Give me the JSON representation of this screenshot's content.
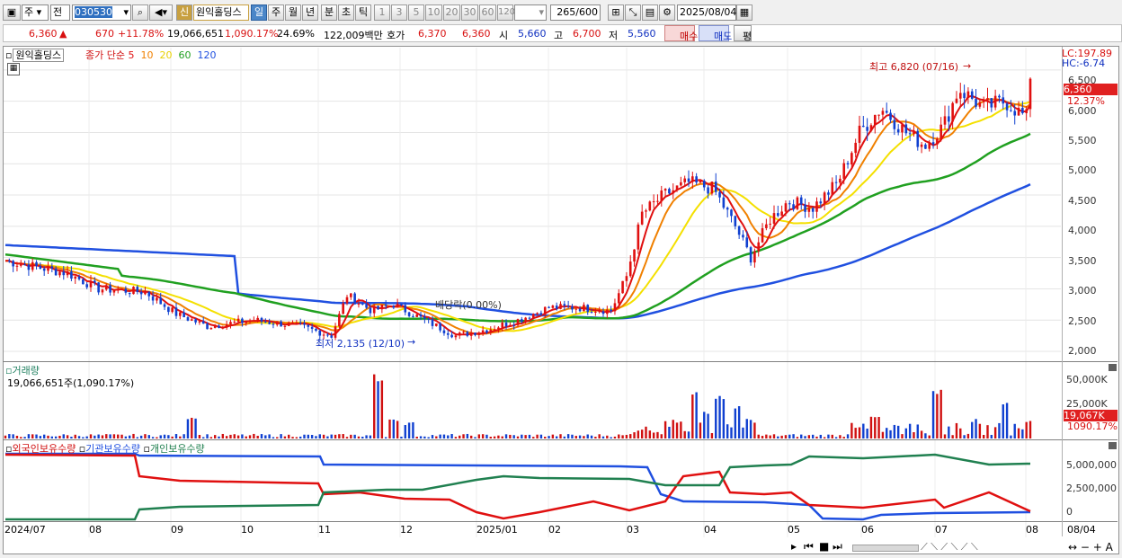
{
  "toolbar": {
    "market_select": "주",
    "prev_label": "전",
    "stock_code": "030530",
    "new_badge": "신",
    "stock_name": "원익홀딩스",
    "periods": [
      "일",
      "주",
      "월",
      "년",
      "분",
      "초",
      "틱"
    ],
    "active_period": "일",
    "intervals": [
      "1",
      "3",
      "5",
      "10",
      "20",
      "30",
      "60",
      "120"
    ],
    "count": "265",
    "count_max": "/600",
    "date": "2025/08/04"
  },
  "info": {
    "price": "6,360",
    "change": "670",
    "change_pct": "+11.78%",
    "volume": "19,066,651",
    "volume_pct": "1,090.17%",
    "turnover": "24.69%",
    "amount": "122,009백만",
    "quote_label": "호가",
    "ask": "6,370",
    "bid": "6,360",
    "open_label": "시",
    "open": "5,660",
    "high_label": "고",
    "high": "6,700",
    "low_label": "저",
    "low": "5,560",
    "buy_btn": "매수",
    "sell_btn": "매도",
    "avg_btn": "평"
  },
  "price_panel": {
    "stock_label": "원익홀딩스",
    "ma_title": "종가 단순",
    "ma_periods": [
      "5",
      "10",
      "20",
      "60",
      "120"
    ],
    "ma_colors": [
      "#e01010",
      "#f08000",
      "#f0e000",
      "#20a020",
      "#2050e0"
    ],
    "lc_label": "LC:197.89",
    "hc_label": "HC:-6.74",
    "current_label": "6,360",
    "current_pct": "12.37%",
    "high_annot": "최고 6,820 (07/16)",
    "low_annot": "최저 2,135 (12/10)",
    "dividend_annot": "배당락(0.00%)",
    "yticks": [
      "6,500",
      "6,000",
      "5,500",
      "5,000",
      "4,500",
      "4,000",
      "3,500",
      "3,000",
      "2,500",
      "2,000"
    ]
  },
  "volume_panel": {
    "title": "거래량",
    "value": "19,066,651주(1,090.17%)",
    "yticks": [
      "50,000K",
      "25,000K"
    ],
    "current_label": "19,067K",
    "current_pct": "1090.17%"
  },
  "holding_panel": {
    "legend": [
      "외국인보유수량",
      "기관보유수량",
      "개인보유수량"
    ],
    "legend_colors": [
      "#e01010",
      "#2050e0",
      "#208050"
    ],
    "yticks": [
      "5,000,000",
      "2,500,000",
      "0"
    ]
  },
  "xaxis": [
    "2024/07",
    "08",
    "09",
    "10",
    "11",
    "12",
    "2025/01",
    "02",
    "03",
    "04",
    "05",
    "06",
    "07",
    "08",
    "08/04"
  ]
}
